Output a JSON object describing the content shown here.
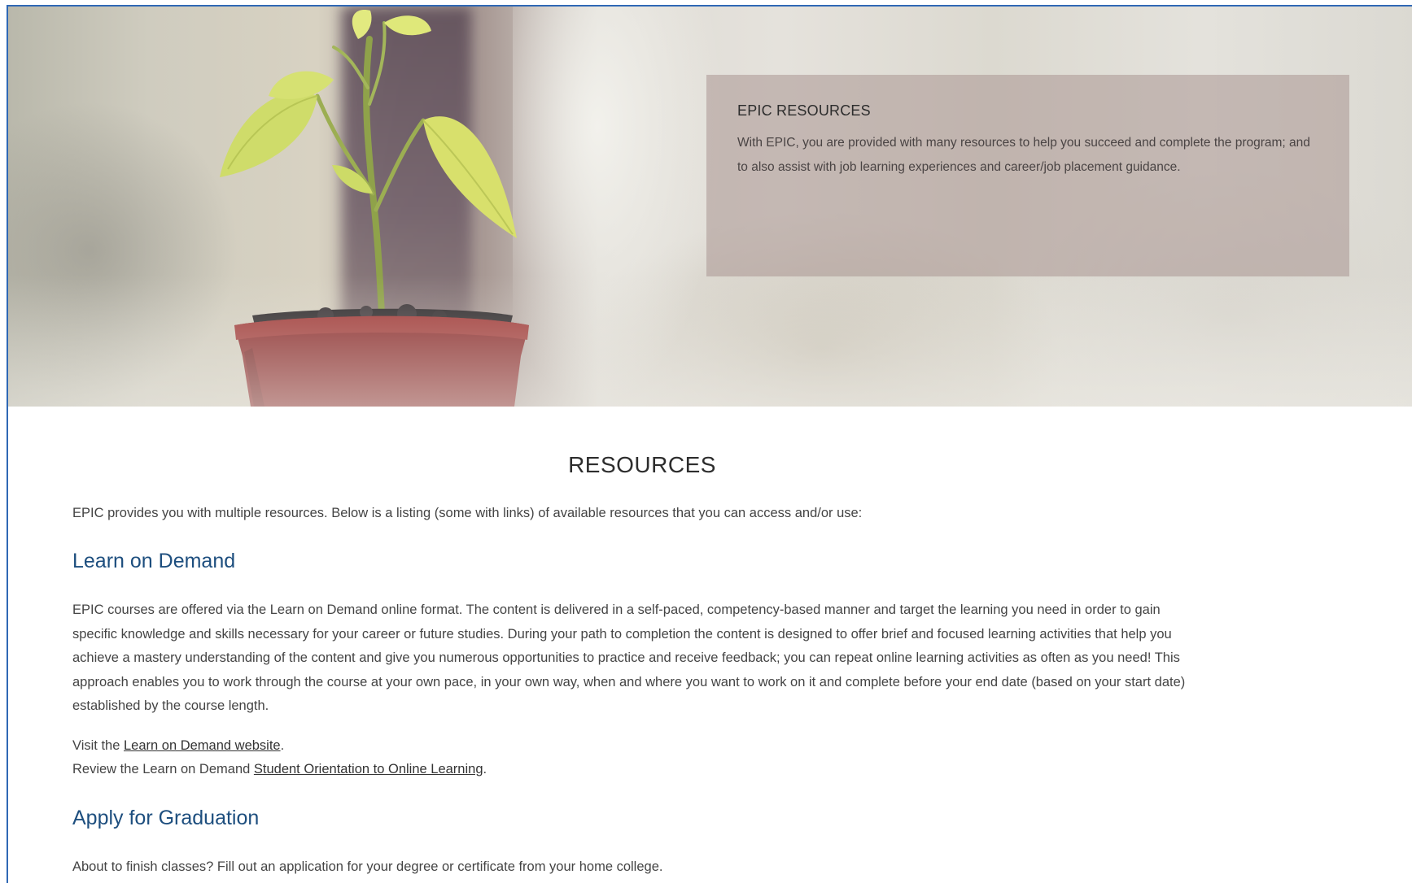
{
  "hero": {
    "card_title": "EPIC RESOURCES",
    "card_text": "With EPIC, you are provided with many resources to help you succeed and complete the program; and to also assist with job learning experiences and career/job placement guidance."
  },
  "main": {
    "title": "RESOURCES",
    "intro": "EPIC provides you with multiple resources. Below is a listing (some with links) of available resources that you can access and/or use:",
    "learn_on_demand": {
      "heading": "Learn on Demand",
      "paragraph": "EPIC courses are offered via the Learn on Demand online format. The content is delivered in a self-paced, competency-based manner and target the learning you need in order to gain specific knowledge and skills necessary for your career or future studies. During your path to completion the content is designed to offer brief and focused learning activities that help you achieve a mastery understanding of the content and give you numerous opportunities to practice and receive feedback; you can repeat online learning activities as often as you need! This approach enables you to work through the course at your own pace, in your own way, when and where you want to work on it and complete before your end date (based on your start date) established by the course length.",
      "visit_prefix": "Visit the ",
      "visit_link": "Learn on Demand website",
      "visit_suffix": ".",
      "review_prefix": "Review the Learn on Demand ",
      "review_link": "Student Orientation to Online Learning",
      "review_suffix": "."
    },
    "apply_graduation": {
      "heading": "Apply for Graduation",
      "text": "About to finish classes?  Fill out an application for your degree or certificate from your home college."
    }
  },
  "colors": {
    "heading_blue": "#1d4e7e",
    "frame_border": "#2f68b5",
    "body_text": "#444444"
  }
}
